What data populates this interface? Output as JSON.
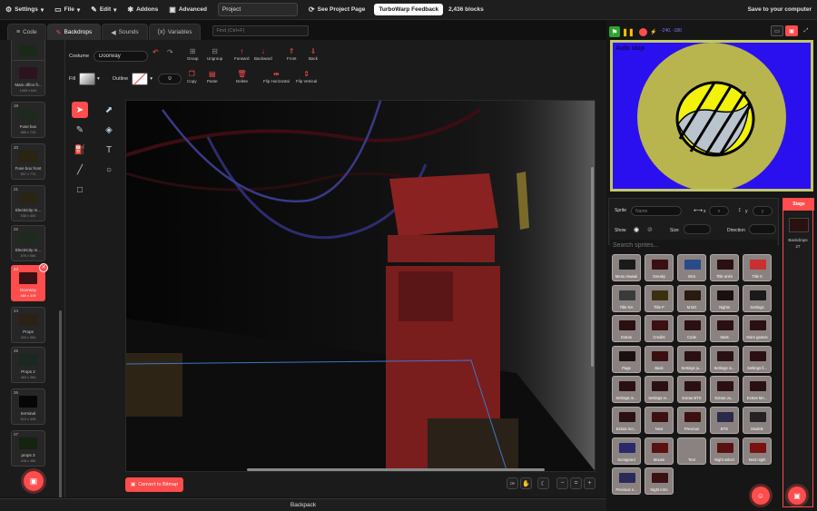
{
  "menubar": {
    "settings": "Settings",
    "file": "File",
    "edit": "Edit",
    "addons": "Addons",
    "advanced": "Advanced",
    "project_title": "Project",
    "see_project_page": "See Project Page",
    "feedback": "TurboWarp Feedback",
    "blocks": "2,436 blocks",
    "save": "Save to your computer"
  },
  "tabs": {
    "code": "Code",
    "backdrops": "Backdrops",
    "sounds": "Sounds",
    "variables": "Variables",
    "find_placeholder": "Find (Ctrl+F)"
  },
  "costumes": [
    {
      "num": "",
      "name": "Outside ma...",
      "size": "480 x 270"
    },
    {
      "num": "",
      "name": "Main office fr...",
      "size": "1065 x 640"
    },
    {
      "num": "19",
      "name": "Fuse box",
      "size": "888 x 726"
    },
    {
      "num": "20",
      "name": "Fuse box front",
      "size": "807 x 774"
    },
    {
      "num": "21",
      "name": "Electricity m...",
      "size": "538 x 450"
    },
    {
      "num": "22",
      "name": "Electricity m...",
      "size": "876 x 586"
    },
    {
      "num": "23",
      "name": "Doorway",
      "size": "480 x 419"
    },
    {
      "num": "24",
      "name": "Props",
      "size": "434 x 386"
    },
    {
      "num": "25",
      "name": "Props 2",
      "size": "463 x 386"
    },
    {
      "num": "26",
      "name": "terminal",
      "size": "519 x 445"
    },
    {
      "num": "27",
      "name": "props 3",
      "size": "438 x 386"
    }
  ],
  "editor": {
    "costume_label": "Costume",
    "costume_name": "Doorway",
    "fill_label": "Fill",
    "outline_label": "Outline",
    "outline_width": "0",
    "group": "Group",
    "ungroup": "Ungroup",
    "forward": "Forward",
    "backward": "Backward",
    "front": "Front",
    "back": "Back",
    "copy": "Copy",
    "paste": "Paste",
    "delete": "Delete",
    "flip_h": "Flip Horizontal",
    "flip_v": "Flip Vertical",
    "convert": "Convert to Bitmap",
    "zoom_reset": "="
  },
  "backpack": "Backpack",
  "stage": {
    "fps": "-240, -180",
    "label": "Auto skip"
  },
  "sprite_info": {
    "sprite_label": "Sprite",
    "name_placeholder": "Name",
    "x_label": "x",
    "y_label": "y",
    "x_placeholder": "x",
    "y_placeholder": "y",
    "show_label": "Show",
    "size_label": "Size",
    "direction_label": "Direction",
    "search_placeholder": "Search sprites..."
  },
  "sprites": [
    "Menu Hawaii",
    "Sneaky",
    "Intro",
    "Title anim",
    "Title 5",
    "Title NA",
    "Title P",
    "M BG",
    "Nights",
    "Settings",
    "Extras",
    "Credits",
    "Code",
    "Stats",
    "More games",
    "Page",
    "Back",
    "Settings ju...",
    "Settings in...",
    "Settings fi...",
    "Settings m...",
    "Settings re...",
    "Extras BTS",
    "Extras Ju...",
    "Extras Mo...",
    "Extras Scr...",
    "Next",
    "Previous",
    "BTS",
    "Models",
    "Screppred",
    "Mouse",
    "Text",
    "Night select",
    "Next night",
    "Previous n...",
    "Night intro"
  ],
  "stage_panel": {
    "tab": "Stage",
    "backdrops_label": "Backdrops",
    "backdrops_count": "27"
  },
  "colors": {
    "accent": "#ff4c4c",
    "stage_bg": "#2a10ee",
    "stage_border": "#c2c76a"
  }
}
